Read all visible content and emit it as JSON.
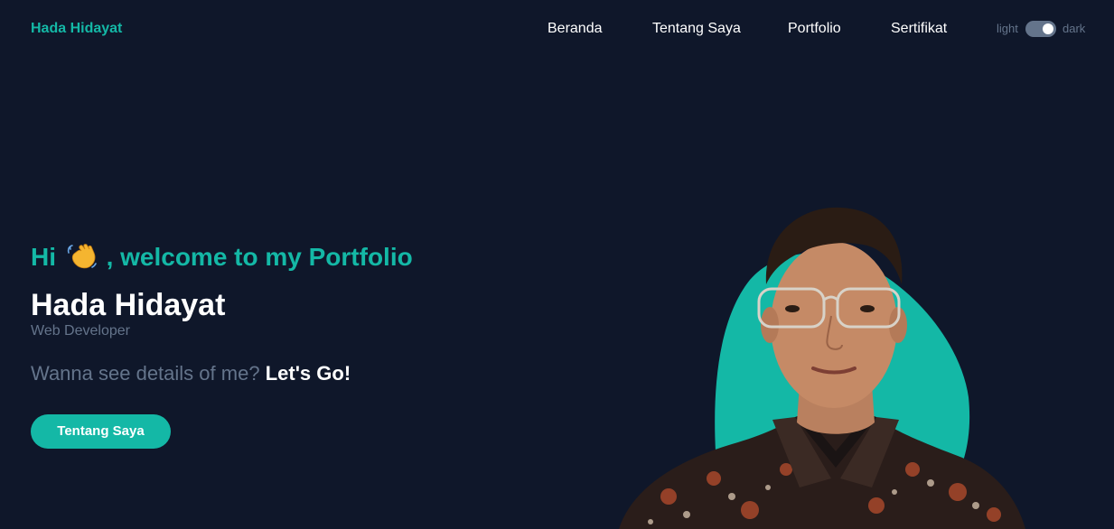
{
  "header": {
    "brand": "Hada Hidayat",
    "nav": [
      {
        "label": "Beranda"
      },
      {
        "label": "Tentang Saya"
      },
      {
        "label": "Portfolio"
      },
      {
        "label": "Sertifikat"
      }
    ],
    "theme_switch": {
      "light_label": "light",
      "dark_label": "dark",
      "state": "dark"
    }
  },
  "hero": {
    "greeting_prefix": "Hi",
    "greeting_emoji": "waving-hand-icon",
    "greeting_suffix": ", welcome to my Portfolio",
    "name": "Hada Hidayat",
    "role": "Web Developer",
    "cta_text": "Wanna see details of me?",
    "cta_strong": "Let's Go!",
    "button_label": "Tentang Saya"
  },
  "colors": {
    "background": "#0f172a",
    "accent": "#14b8a6",
    "muted": "#64748b",
    "text": "#ffffff"
  }
}
